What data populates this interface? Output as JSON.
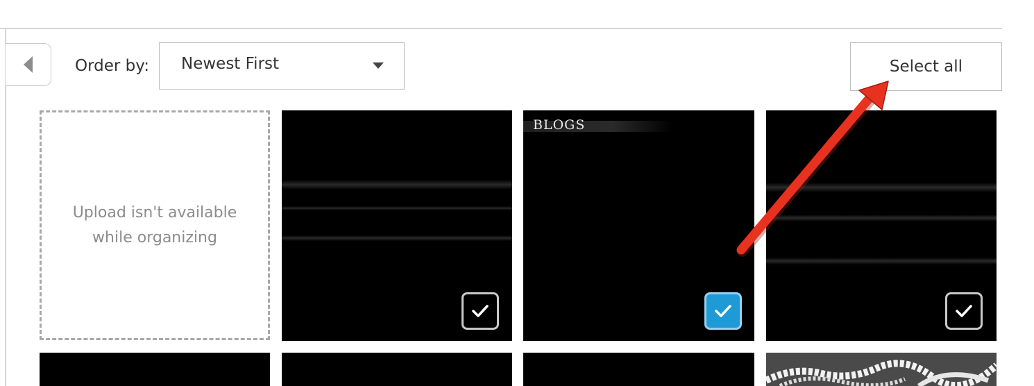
{
  "toolbar": {
    "order_label": "Order by:",
    "order_value": "Newest First",
    "select_all_label": "Select all"
  },
  "grid": {
    "upload_message": "Upload isn't available while organizing",
    "tiles": [
      {
        "caption": "",
        "selected": false
      },
      {
        "caption": "BLOGS",
        "selected": true
      },
      {
        "caption": "",
        "selected": false
      }
    ]
  },
  "colors": {
    "checkbox_selected": "#1e9ad6",
    "annotation_arrow": "#e8321f"
  },
  "icons": {
    "back": "triangle-left-icon",
    "dropdown": "caret-down-icon",
    "check": "checkmark-icon"
  }
}
